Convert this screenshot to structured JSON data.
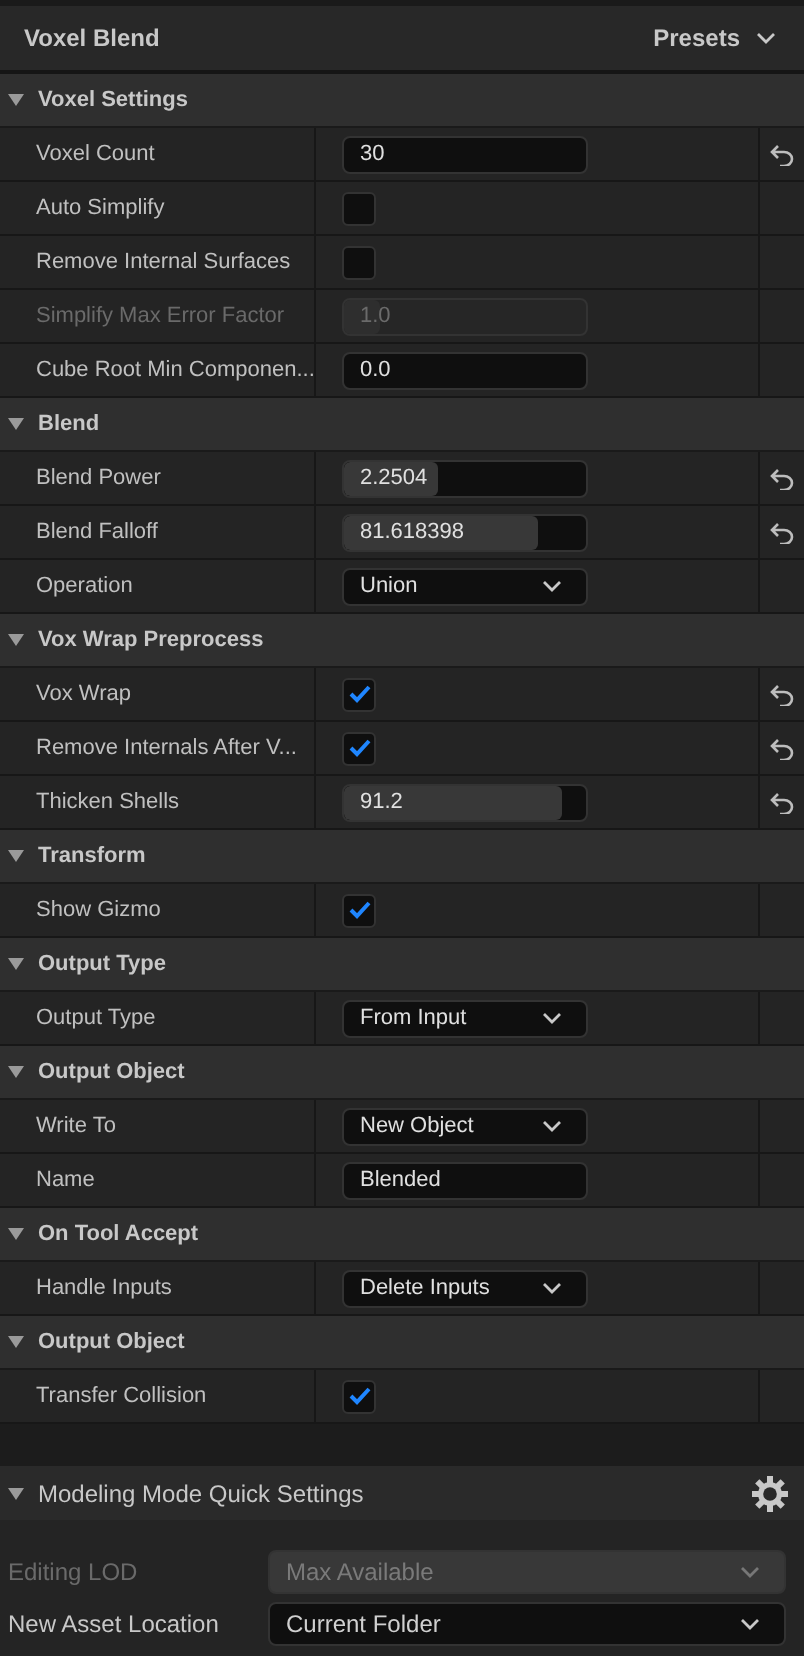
{
  "panel": {
    "title": "Voxel Blend",
    "presets_button": "Presets"
  },
  "sections": [
    {
      "title": "Voxel Settings",
      "expanded": true,
      "rows": [
        {
          "label": "Voxel Count",
          "kind": "number",
          "value": "30",
          "reset": true,
          "disabled": false
        },
        {
          "label": "Auto Simplify",
          "kind": "checkbox",
          "checked": false,
          "reset": false,
          "disabled": false
        },
        {
          "label": "Remove Internal Surfaces",
          "kind": "checkbox",
          "checked": false,
          "reset": false,
          "disabled": false
        },
        {
          "label": "Simplify Max Error Factor",
          "kind": "number",
          "value": "1.0",
          "level": 0.15,
          "reset": false,
          "disabled": true
        },
        {
          "label": "Cube Root Min Componen...",
          "kind": "number",
          "value": "0.0",
          "reset": false,
          "disabled": false
        }
      ]
    },
    {
      "title": "Blend",
      "expanded": true,
      "rows": [
        {
          "label": "Blend Power",
          "kind": "number",
          "value": "2.2504",
          "level": 0.39,
          "reset": true,
          "disabled": false
        },
        {
          "label": "Blend Falloff",
          "kind": "number",
          "value": "81.618398",
          "level": 0.8,
          "reset": true,
          "disabled": false
        },
        {
          "label": "Operation",
          "kind": "dropdown",
          "value": "Union",
          "reset": false,
          "disabled": false
        }
      ]
    },
    {
      "title": "Vox Wrap Preprocess",
      "expanded": true,
      "rows": [
        {
          "label": "Vox Wrap",
          "kind": "checkbox",
          "checked": true,
          "reset": true,
          "disabled": false
        },
        {
          "label": "Remove Internals After V...",
          "kind": "checkbox",
          "checked": true,
          "reset": true,
          "disabled": false
        },
        {
          "label": "Thicken Shells",
          "kind": "number",
          "value": "91.2",
          "level": 0.9,
          "reset": true,
          "disabled": false
        }
      ]
    },
    {
      "title": "Transform",
      "expanded": true,
      "rows": [
        {
          "label": "Show Gizmo",
          "kind": "checkbox",
          "checked": true,
          "reset": false,
          "disabled": false
        }
      ]
    },
    {
      "title": "Output Type",
      "expanded": true,
      "rows": [
        {
          "label": "Output Type",
          "kind": "dropdown",
          "value": "From Input",
          "reset": false,
          "disabled": false
        }
      ]
    },
    {
      "title": "Output Object",
      "expanded": true,
      "rows": [
        {
          "label": "Write To",
          "kind": "dropdown",
          "value": "New Object",
          "reset": false,
          "disabled": false
        },
        {
          "label": "Name",
          "kind": "text",
          "value": "Blended",
          "reset": false,
          "disabled": false
        }
      ]
    },
    {
      "title": "On Tool Accept",
      "expanded": true,
      "rows": [
        {
          "label": "Handle Inputs",
          "kind": "dropdown",
          "value": "Delete Inputs",
          "reset": false,
          "disabled": false
        }
      ]
    },
    {
      "title": "Output Object",
      "expanded": true,
      "rows": [
        {
          "label": "Transfer Collision",
          "kind": "checkbox",
          "checked": true,
          "reset": false,
          "disabled": false
        }
      ]
    }
  ],
  "quick_settings": {
    "title": "Modeling Mode Quick Settings",
    "expanded": true,
    "rows": [
      {
        "label": "Editing LOD",
        "value": "Max Available",
        "disabled": true
      },
      {
        "label": "New Asset Location",
        "value": "Current Folder",
        "disabled": false
      }
    ]
  }
}
